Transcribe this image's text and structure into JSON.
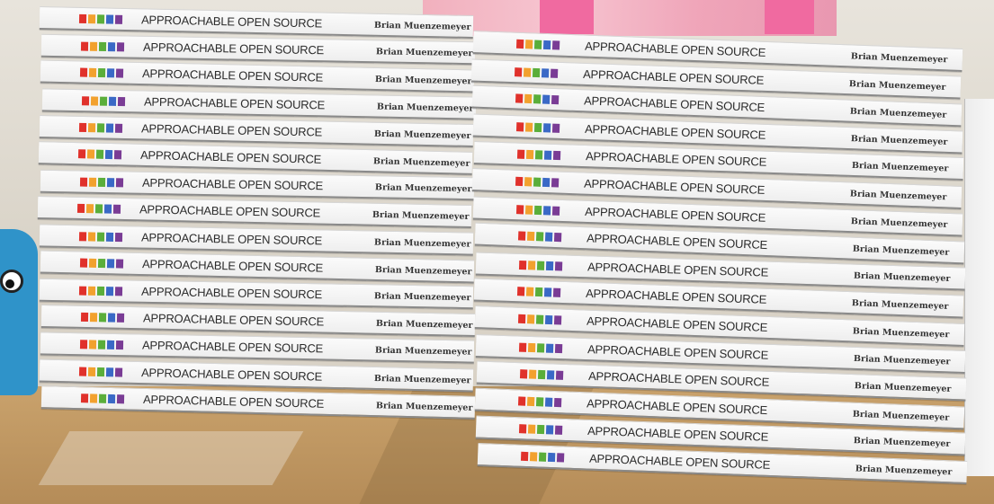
{
  "book": {
    "title": "APPROACHABLE OPEN SOURCE",
    "author": "Brian Muenzemeyer",
    "logo_colors": [
      "#e0312b",
      "#f2a12e",
      "#5aae3a",
      "#3a69c6",
      "#7a3c95"
    ]
  },
  "stacks": {
    "left_count": 15,
    "right_count": 16
  }
}
